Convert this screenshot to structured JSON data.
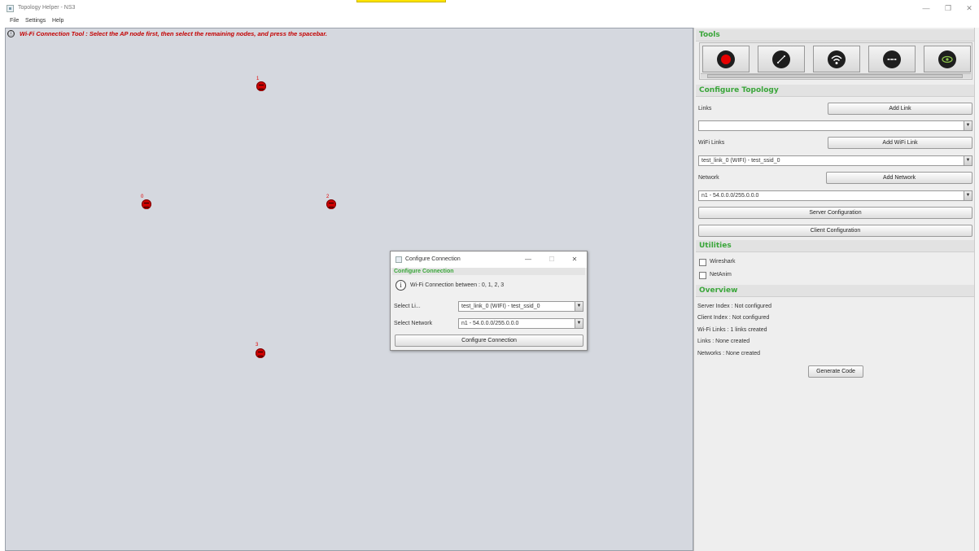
{
  "window": {
    "title": "Topology Helper - NS3",
    "controls": {
      "minimize": "—",
      "maximize": "❐",
      "close": "✕"
    }
  },
  "menu": [
    "File",
    "Settings",
    "Help"
  ],
  "canvas": {
    "info_icon": "ⓘ",
    "info_text": "Wi-Fi Connection Tool : Select the AP node first, then select the remaining nodes, and press the spacebar.",
    "nodes": [
      {
        "id": "1"
      },
      {
        "id": "0"
      },
      {
        "id": "2"
      },
      {
        "id": "3"
      }
    ]
  },
  "panel": {
    "tools_header": "Tools",
    "tools": [
      {
        "name": "record-icon",
        "color": "#e60000"
      },
      {
        "name": "link-line-icon"
      },
      {
        "name": "wifi-icon"
      },
      {
        "name": "network-icon"
      },
      {
        "name": "eye-icon",
        "color": "#8bc34a"
      }
    ],
    "configure_header": "Configure Topology",
    "links_label": "Links",
    "add_link": "Add Link",
    "links_select": "",
    "wifi_links_label": "WiFi Links",
    "add_wifi_link": "Add WiFi Link",
    "wifi_links_select": "test_link_0 (WIFI) - test_ssid_0",
    "network_label": "Network",
    "add_network": "Add Network",
    "network_select": "n1 - 54.0.0.0/255.0.0.0",
    "server_config": "Server Configuration",
    "client_config": "Client Configuration",
    "utilities_header": "Utilities",
    "wireshark": "Wireshark",
    "netanim": "NetAnim",
    "overview_header": "Overview",
    "overview": {
      "server_index": "Server Index :  Not configured",
      "client_index": "Client Index :  Not configured",
      "wifi_links": "Wi-Fi Links : 1 links created",
      "links": "Links :  None created",
      "networks": "Networks : None created"
    },
    "generate_code": "Generate Code"
  },
  "dialog": {
    "title": "Configure Connection",
    "header": "Configure Connection",
    "info_icon": "i",
    "info_text": "Wi-Fi Connection between : 0, 1, 2, 3",
    "select_link_label": "Select Li...",
    "select_link_value": "test_link_0 (WIFI) - test_ssid_0",
    "select_network_label": "Select Network",
    "select_network_value": "n1 - 54.0.0.0/255.0.0.0",
    "configure_button": "Configure Connection",
    "controls": {
      "minimize": "—",
      "maximize": "☐",
      "close": "✕"
    }
  }
}
